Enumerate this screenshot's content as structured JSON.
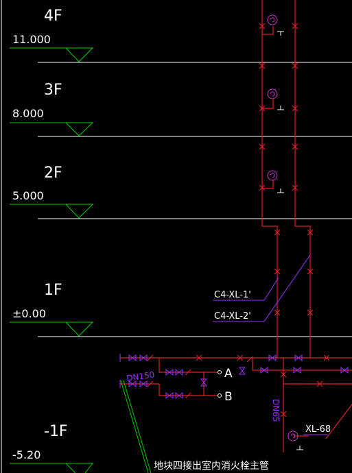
{
  "floors": [
    {
      "name": "4F",
      "elevation": "11.000"
    },
    {
      "name": "3F",
      "elevation": "8.000"
    },
    {
      "name": "2F",
      "elevation": "5.000"
    },
    {
      "name": "1F",
      "elevation": "±0.00"
    },
    {
      "name": "-1F",
      "elevation": "-5.20"
    }
  ],
  "riser_labels": [
    "C4-XL-1'",
    "C4-XL-2'"
  ],
  "pipe_labels": {
    "dn150": "DN150",
    "dn65": "DN65",
    "xl68": "XL-68",
    "point_a": "A",
    "point_b": "B"
  },
  "note": "地块四接出室内消火栓主管",
  "colors": {
    "background": "#000000",
    "floor_line": "#ffffff",
    "elevation_symbol": "#00cc00",
    "pipe": "#e0202a",
    "valve": "#9b30ff",
    "hydrant": "#d030d0",
    "text": "#ffffff"
  }
}
